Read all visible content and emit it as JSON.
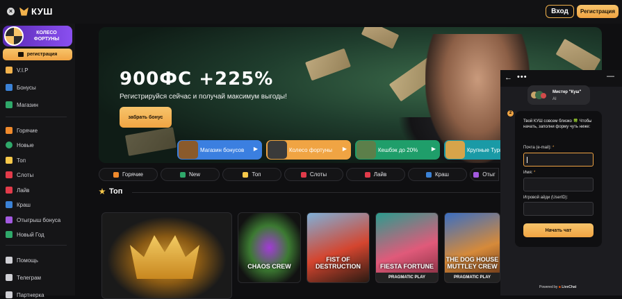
{
  "header": {
    "logo_text": "КУШ",
    "login_label": "Вход",
    "register_label": "Регистрация"
  },
  "sidebar": {
    "wheel_label": "КОЛЕСО ФОРТУНЫ",
    "register_label": "регистрация",
    "items": [
      {
        "label": "V.I.P",
        "icon": "crown-icon",
        "color": "#f2b24c"
      },
      {
        "label": "Бонусы",
        "icon": "gift-icon",
        "color": "#3b82d6"
      },
      {
        "label": "Магазин",
        "icon": "shop-icon",
        "color": "#2fa86a"
      },
      {
        "label": "Горячие",
        "icon": "fire-icon",
        "color": "#f08a2c"
      },
      {
        "label": "Новые",
        "icon": "new-icon",
        "color": "#2fa86a"
      },
      {
        "label": "Топ",
        "icon": "star-icon",
        "color": "#f7c84a"
      },
      {
        "label": "Слоты",
        "icon": "cherry-icon",
        "color": "#e23b4a"
      },
      {
        "label": "Лайв",
        "icon": "cards-icon",
        "color": "#e23b4a"
      },
      {
        "label": "Краш",
        "icon": "plane-icon",
        "color": "#3b82d6"
      },
      {
        "label": "Отыгрыш бонуса",
        "icon": "wager-icon",
        "color": "#a35ae0"
      },
      {
        "label": "Новый Год",
        "icon": "tree-icon",
        "color": "#2fa86a"
      },
      {
        "label": "Помощь",
        "icon": "headset-icon",
        "color": "#cfcfd4"
      },
      {
        "label": "Телеграм",
        "icon": "telegram-icon",
        "color": "#cfcfd4"
      },
      {
        "label": "Партнерка",
        "icon": "partner-icon",
        "color": "#cfcfd4"
      }
    ]
  },
  "hero": {
    "title": "900ФС +225%",
    "subtitle": "Регистрируйся сейчас и получай максимум выгоды!",
    "button_label": "забрать бонус"
  },
  "promos": [
    {
      "label": "Магазин бонусов",
      "color": "#3b7fe0"
    },
    {
      "label": "Колесо фортуны",
      "color": "#f0a443"
    },
    {
      "label": "Кешбэк до 20%",
      "color": "#1f9e6a"
    },
    {
      "label": "Крупные Турнир",
      "color": "#1a9aa6"
    }
  ],
  "categories": [
    {
      "label": "Горячие",
      "color": "#f08a2c"
    },
    {
      "label": "New",
      "color": "#2fa86a"
    },
    {
      "label": "Топ",
      "color": "#f7c84a"
    },
    {
      "label": "Слоты",
      "color": "#e23b4a"
    },
    {
      "label": "Лайв",
      "color": "#e23b4a"
    },
    {
      "label": "Краш",
      "color": "#3b82d6"
    },
    {
      "label": "Отыг",
      "color": "#a35ae0"
    }
  ],
  "top_section": {
    "title": "Топ"
  },
  "games": [
    {
      "title": "",
      "provider": ""
    },
    {
      "title": "CHAOS CREW",
      "provider": ""
    },
    {
      "title": "FIST OF DESTRUCTION",
      "provider": ""
    },
    {
      "title": "FIESTA FORTUNE",
      "provider": "PRAGMATIC PLAY"
    },
    {
      "title": "THE DOG HOUSE MUTTLEY CREW",
      "provider": "PRAGMATIC PLAY"
    }
  ],
  "chat": {
    "agent_name": "Мистер \"Куш\"",
    "agent_role": "AI",
    "message": "Твой КУШ совсем близко 🍀 Чтобы начать, заполни форму чуть ниже:",
    "unread": "2",
    "email_label": "Почта (e-mail):",
    "name_label": "Имя:",
    "userid_label": "Игровой айди (UserID):",
    "required_mark": "*",
    "start_label": "Начать чат",
    "powered_prefix": "Powered by",
    "powered_brand": "LiveChat"
  }
}
